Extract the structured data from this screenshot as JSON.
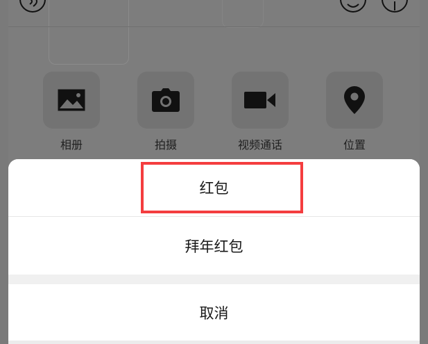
{
  "chat_input": {
    "voice_icon": "voice-icon",
    "emoji_icon": "emoji-icon",
    "plus_icon": "plus-icon"
  },
  "toolbox": {
    "items": [
      {
        "label": "相册",
        "icon": "album-icon"
      },
      {
        "label": "拍摄",
        "icon": "camera-icon"
      },
      {
        "label": "视频通话",
        "icon": "video-icon"
      },
      {
        "label": "位置",
        "icon": "location-pin-icon"
      }
    ]
  },
  "action_sheet": {
    "options": [
      {
        "label": "红包"
      },
      {
        "label": "拜年红包"
      }
    ],
    "cancel_label": "取消",
    "highlight_color": "#f43d3f"
  }
}
